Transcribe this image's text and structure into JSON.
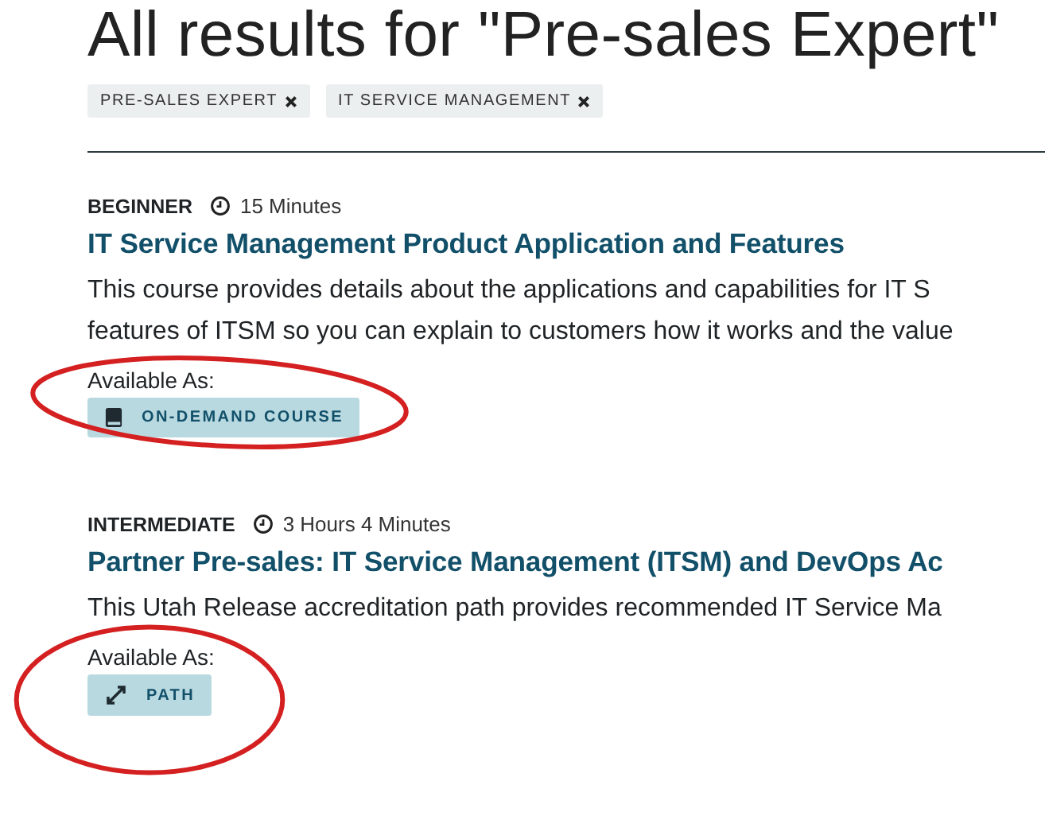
{
  "heading": "All results for \"Pre-sales Expert\"",
  "filters": [
    {
      "label": "PRE-SALES EXPERT"
    },
    {
      "label": "IT SERVICE MANAGEMENT"
    }
  ],
  "results": [
    {
      "level": "BEGINNER",
      "duration": "15 Minutes",
      "title": "IT Service Management Product Application and Features",
      "description": "This course provides details about the applications and capabilities for IT S\nfeatures of ITSM so you can explain to customers how it works and the value",
      "available_label": "Available As:",
      "formats": [
        {
          "kind": "course",
          "label": "ON-DEMAND COURSE"
        }
      ],
      "circled": true
    },
    {
      "level": "INTERMEDIATE",
      "duration": "3 Hours 4 Minutes",
      "title": "Partner Pre-sales: IT Service Management (ITSM) and DevOps Ac",
      "description": "This Utah Release accreditation path provides recommended IT Service Ma",
      "available_label": "Available As:",
      "formats": [
        {
          "kind": "path",
          "label": "PATH"
        }
      ],
      "circled": true
    }
  ]
}
